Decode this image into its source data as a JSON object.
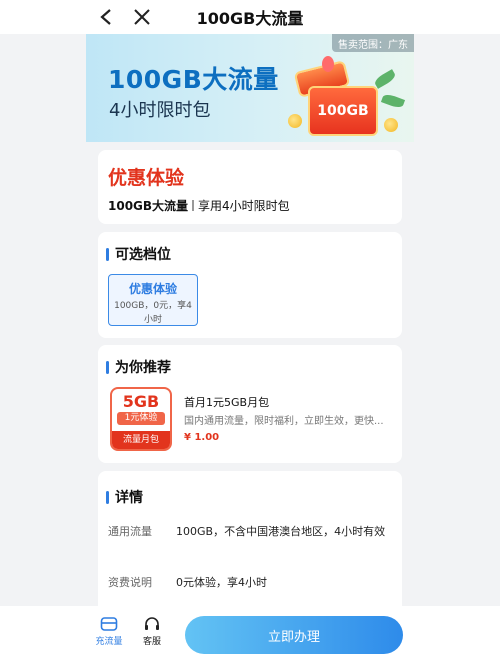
{
  "nav": {
    "title": "100GB大流量",
    "back_icon": "chevron-left-icon",
    "close_icon": "close-icon"
  },
  "banner": {
    "region_label": "售卖范围：广东",
    "title": "100GB大流量",
    "subtitle": "4小时限时包",
    "box_label": "100GB"
  },
  "offer": {
    "title": "优惠体验",
    "desc_main": "100GB大流量",
    "desc_sub": "享用4小时限时包"
  },
  "tiers": {
    "heading": "可选档位",
    "options": [
      {
        "name": "优惠体验",
        "desc": "100GB，0元，享4小时"
      }
    ]
  },
  "recommend": {
    "heading": "为你推荐",
    "item": {
      "thumb_main": "5GB",
      "thumb_badge": "1元体验",
      "thumb_footer": "流量月包",
      "name": "首月1元5GB月包",
      "desc": "国内通用流量，限时福利，立即生效，更快...",
      "price": "¥ 1.00"
    }
  },
  "details": {
    "heading": "详情",
    "rows": [
      {
        "label": "通用流量",
        "value": "100GB，不含中国港澳台地区，4小时有效"
      },
      {
        "label": "资费说明",
        "value": "0元体验，享4小时"
      }
    ]
  },
  "bottom": {
    "tab_flow": "充流量",
    "tab_service": "客服",
    "apply": "立即办理"
  },
  "colors": {
    "accent": "#2f7de1",
    "highlight": "#e2341d"
  }
}
